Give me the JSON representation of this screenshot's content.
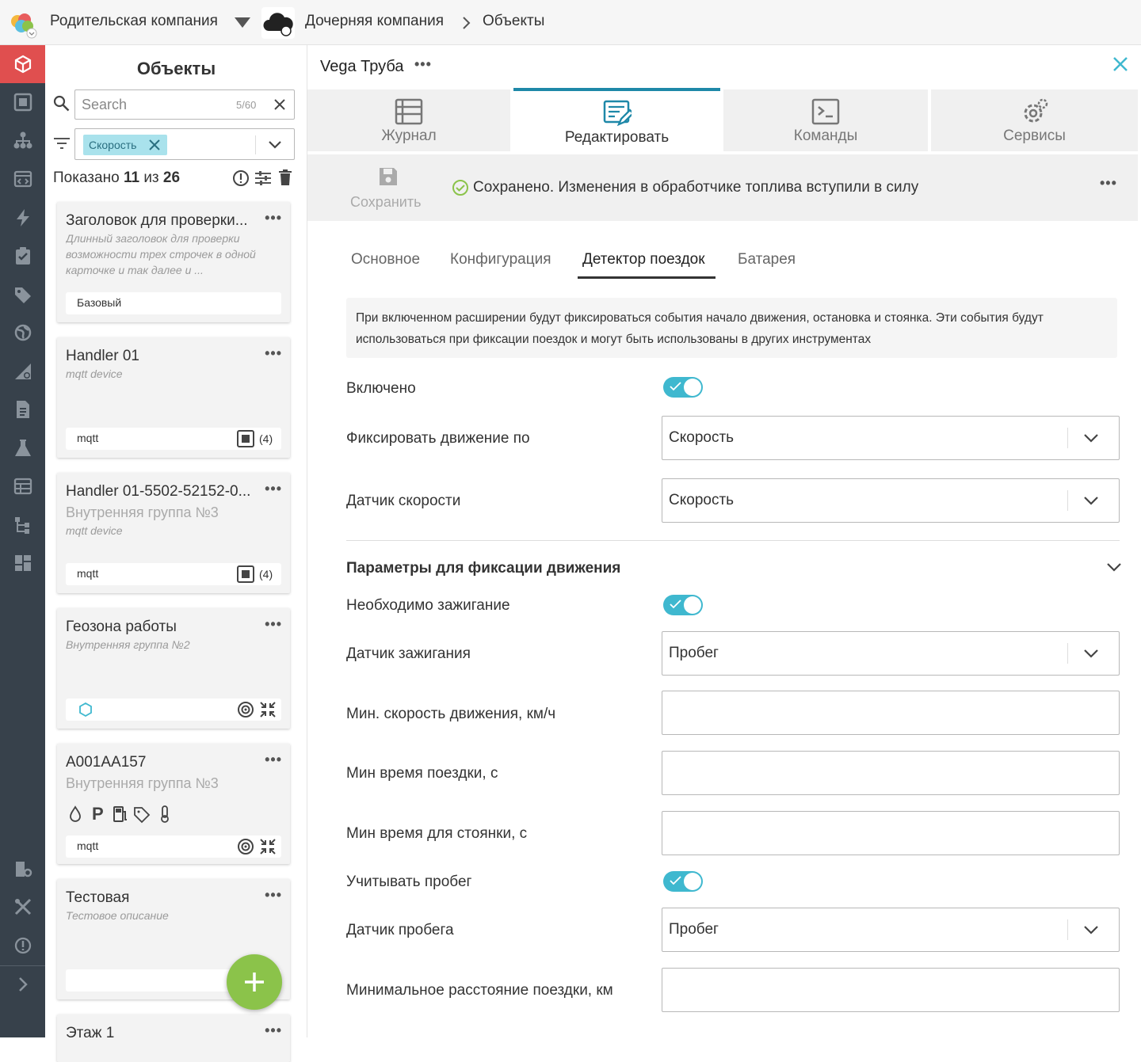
{
  "topbar": {
    "parent_company": "Родительская компания",
    "child_company": "Дочерняя компания",
    "breadcrumb_current": "Объекты"
  },
  "sidebar": {
    "items": [
      "cube-icon",
      "square-frame-icon",
      "hierarchy-icon",
      "code-window-icon",
      "lightning-icon",
      "clipboard-check-icon",
      "tag-icon",
      "globe-icon",
      "ruler-pencil-icon",
      "document-icon",
      "flask-icon",
      "table-icon",
      "tree-icon",
      "dashboard-icon",
      "building-gear-icon",
      "tools-icon",
      "alert-icon",
      "chevron-right-icon"
    ],
    "active_color": "#e04f4f"
  },
  "list": {
    "title": "Объекты",
    "search_placeholder": "Search",
    "search_counter": "5/60",
    "filter_chip": "Скорость",
    "shown_prefix": "Показано",
    "shown_count": "11",
    "shown_mid": "из",
    "shown_total": "26",
    "cards": [
      {
        "title": "Заголовок для проверки...",
        "sub": "Длинный заголовок для проверки возможности трех строчек в одной карточке и так далее и ...",
        "foot": "Базовый"
      },
      {
        "title": "Handler 01",
        "sub": "mqtt device",
        "foot": "mqtt",
        "count": "(4)"
      },
      {
        "title": "Handler 01-5502-52152-0...",
        "group": "Внутренняя группа №3",
        "sub": "mqtt device",
        "foot": "mqtt",
        "count": "(4)"
      },
      {
        "title": "Геозона работы",
        "sub": "Внутренняя группа №2"
      },
      {
        "title": "А001АА157",
        "group": "Внутренняя группа №3",
        "foot": "mqtt"
      },
      {
        "title": "Тестовая",
        "sub": "Тестовое описание"
      },
      {
        "title": "Этаж 1"
      }
    ]
  },
  "main": {
    "object_title": "Vega Труба",
    "tabs": [
      "Журнал",
      "Редактировать",
      "Команды",
      "Сервисы"
    ],
    "save_label": "Сохранить",
    "saved_message": "Сохранено. Изменения в обработчике топлива вступили в силу",
    "subtabs": [
      "Основное",
      "Конфигурация",
      "Детектор поездок",
      "Батарея"
    ],
    "info_text": "При включенном расширении будут фиксироваться события начало движения, остановка и стоянка. Эти события будут использоваться при фиксации поездок и могут быть использованы в других инструментах",
    "enabled_label": "Включено",
    "movement_by_label": "Фиксировать движение по",
    "movement_by_value": "Скорость",
    "speed_sensor_label": "Датчик скорости",
    "speed_sensor_value": "Скорость",
    "section_title": "Параметры для фиксации движения",
    "ignition_required_label": "Необходимо зажигание",
    "ignition_sensor_label": "Датчик зажигания",
    "ignition_sensor_value": "Пробег",
    "min_speed_label": "Мин. скорость движения, км/ч",
    "min_trip_time_label": "Мин время поездки, с",
    "min_parking_time_label": "Мин время для стоянки, с",
    "use_mileage_label": "Учитывать пробег",
    "mileage_sensor_label": "Датчик пробега",
    "mileage_sensor_value": "Пробег",
    "min_distance_label": "Минимальное расстояние поездки, км"
  },
  "colors": {
    "accent": "#3fb8cf",
    "active_tab_bar": "#1e88a8",
    "fab": "#8bc34a",
    "sidebar_bg": "#37414b"
  }
}
